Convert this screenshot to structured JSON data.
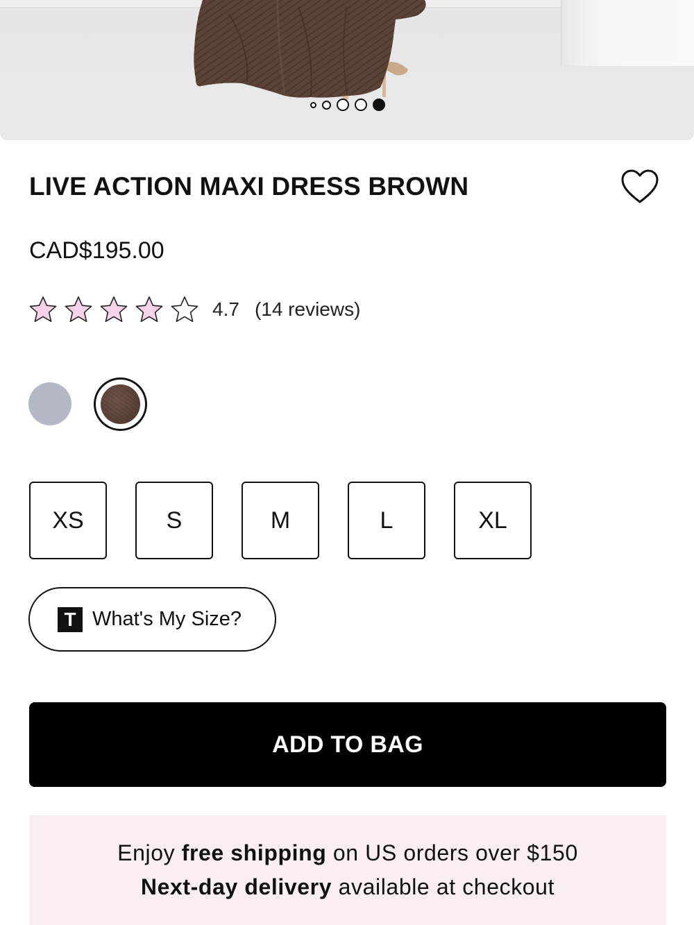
{
  "gallery": {
    "slide_count": 5,
    "active_slide": 5
  },
  "product": {
    "title": "LIVE ACTION MAXI DRESS BROWN",
    "price": "CAD$195.00",
    "rating": {
      "value": "4.7",
      "count_label": "(14 reviews)",
      "stars_shown": 5,
      "star_color": "#f6d3e8"
    },
    "swatches": [
      {
        "color": "#b4b8c6",
        "selected": false
      },
      {
        "color": "#5e463b",
        "selected": true
      }
    ],
    "sizes": [
      "XS",
      "S",
      "M",
      "L",
      "XL"
    ]
  },
  "size_finder": {
    "logo_letter": "T",
    "label": "What's My Size?"
  },
  "add_to_bag": {
    "label": "ADD TO BAG"
  },
  "promo": {
    "line1_pre": "Enjoy ",
    "line1_bold": "free shipping",
    "line1_post": " on US orders over $150",
    "line2_bold": "Next-day delivery",
    "line2_post": " available at checkout",
    "background": "#f9eef1"
  },
  "icons": {
    "wishlist": "heart-icon",
    "star": "star-icon"
  }
}
